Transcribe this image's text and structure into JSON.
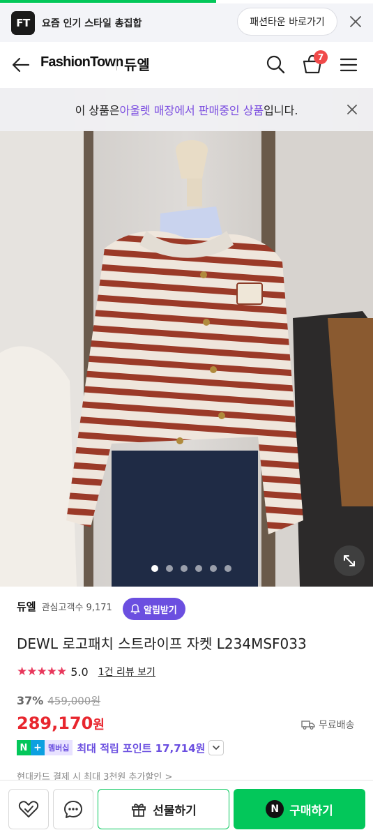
{
  "promo_bar": {
    "logo_text": "FT",
    "text": "요즘 인기 스타일 총집합",
    "button_label": "패션타운 바로가기"
  },
  "header": {
    "store_logo": "FashionTown",
    "brand_name": "듀엘",
    "cart_count": "7"
  },
  "outlet_banner": {
    "prefix": "이 상품은 ",
    "highlight": "아울렛 매장에서 판매중인 상품",
    "suffix": "입니다."
  },
  "gallery": {
    "total_images": 6,
    "active_index": 0
  },
  "product": {
    "brand": "듀엘",
    "interest_label": "관심고객수 9,171",
    "alarm_label": "알림받기",
    "title": "DEWL 로고패치 스트라이프 자켓 L234MSF033",
    "rating_stars": 5,
    "rating": "5.0",
    "review_link": "1건 리뷰 보기",
    "discount": "37%",
    "original_price": "459,000원",
    "price": "289,170",
    "price_unit": "원",
    "shipping": "무료배송",
    "badge_n": "N",
    "badge_plus": "+",
    "badge_membership": "멤버십",
    "points": "최대 적립 포인트 17,714원",
    "card_promo": "현대카드 결제 시 최대 3천원 추가할인 >"
  },
  "bottom_bar": {
    "gift_label": "선물하기",
    "buy_label": "구매하기",
    "npay_glyph": "N"
  },
  "colors": {
    "accent_purple": "#6b4fe0",
    "price_red": "#e8262e",
    "naver_green": "#03c75a",
    "star_pink": "#e8385c",
    "badge_red": "#f04a4a"
  }
}
